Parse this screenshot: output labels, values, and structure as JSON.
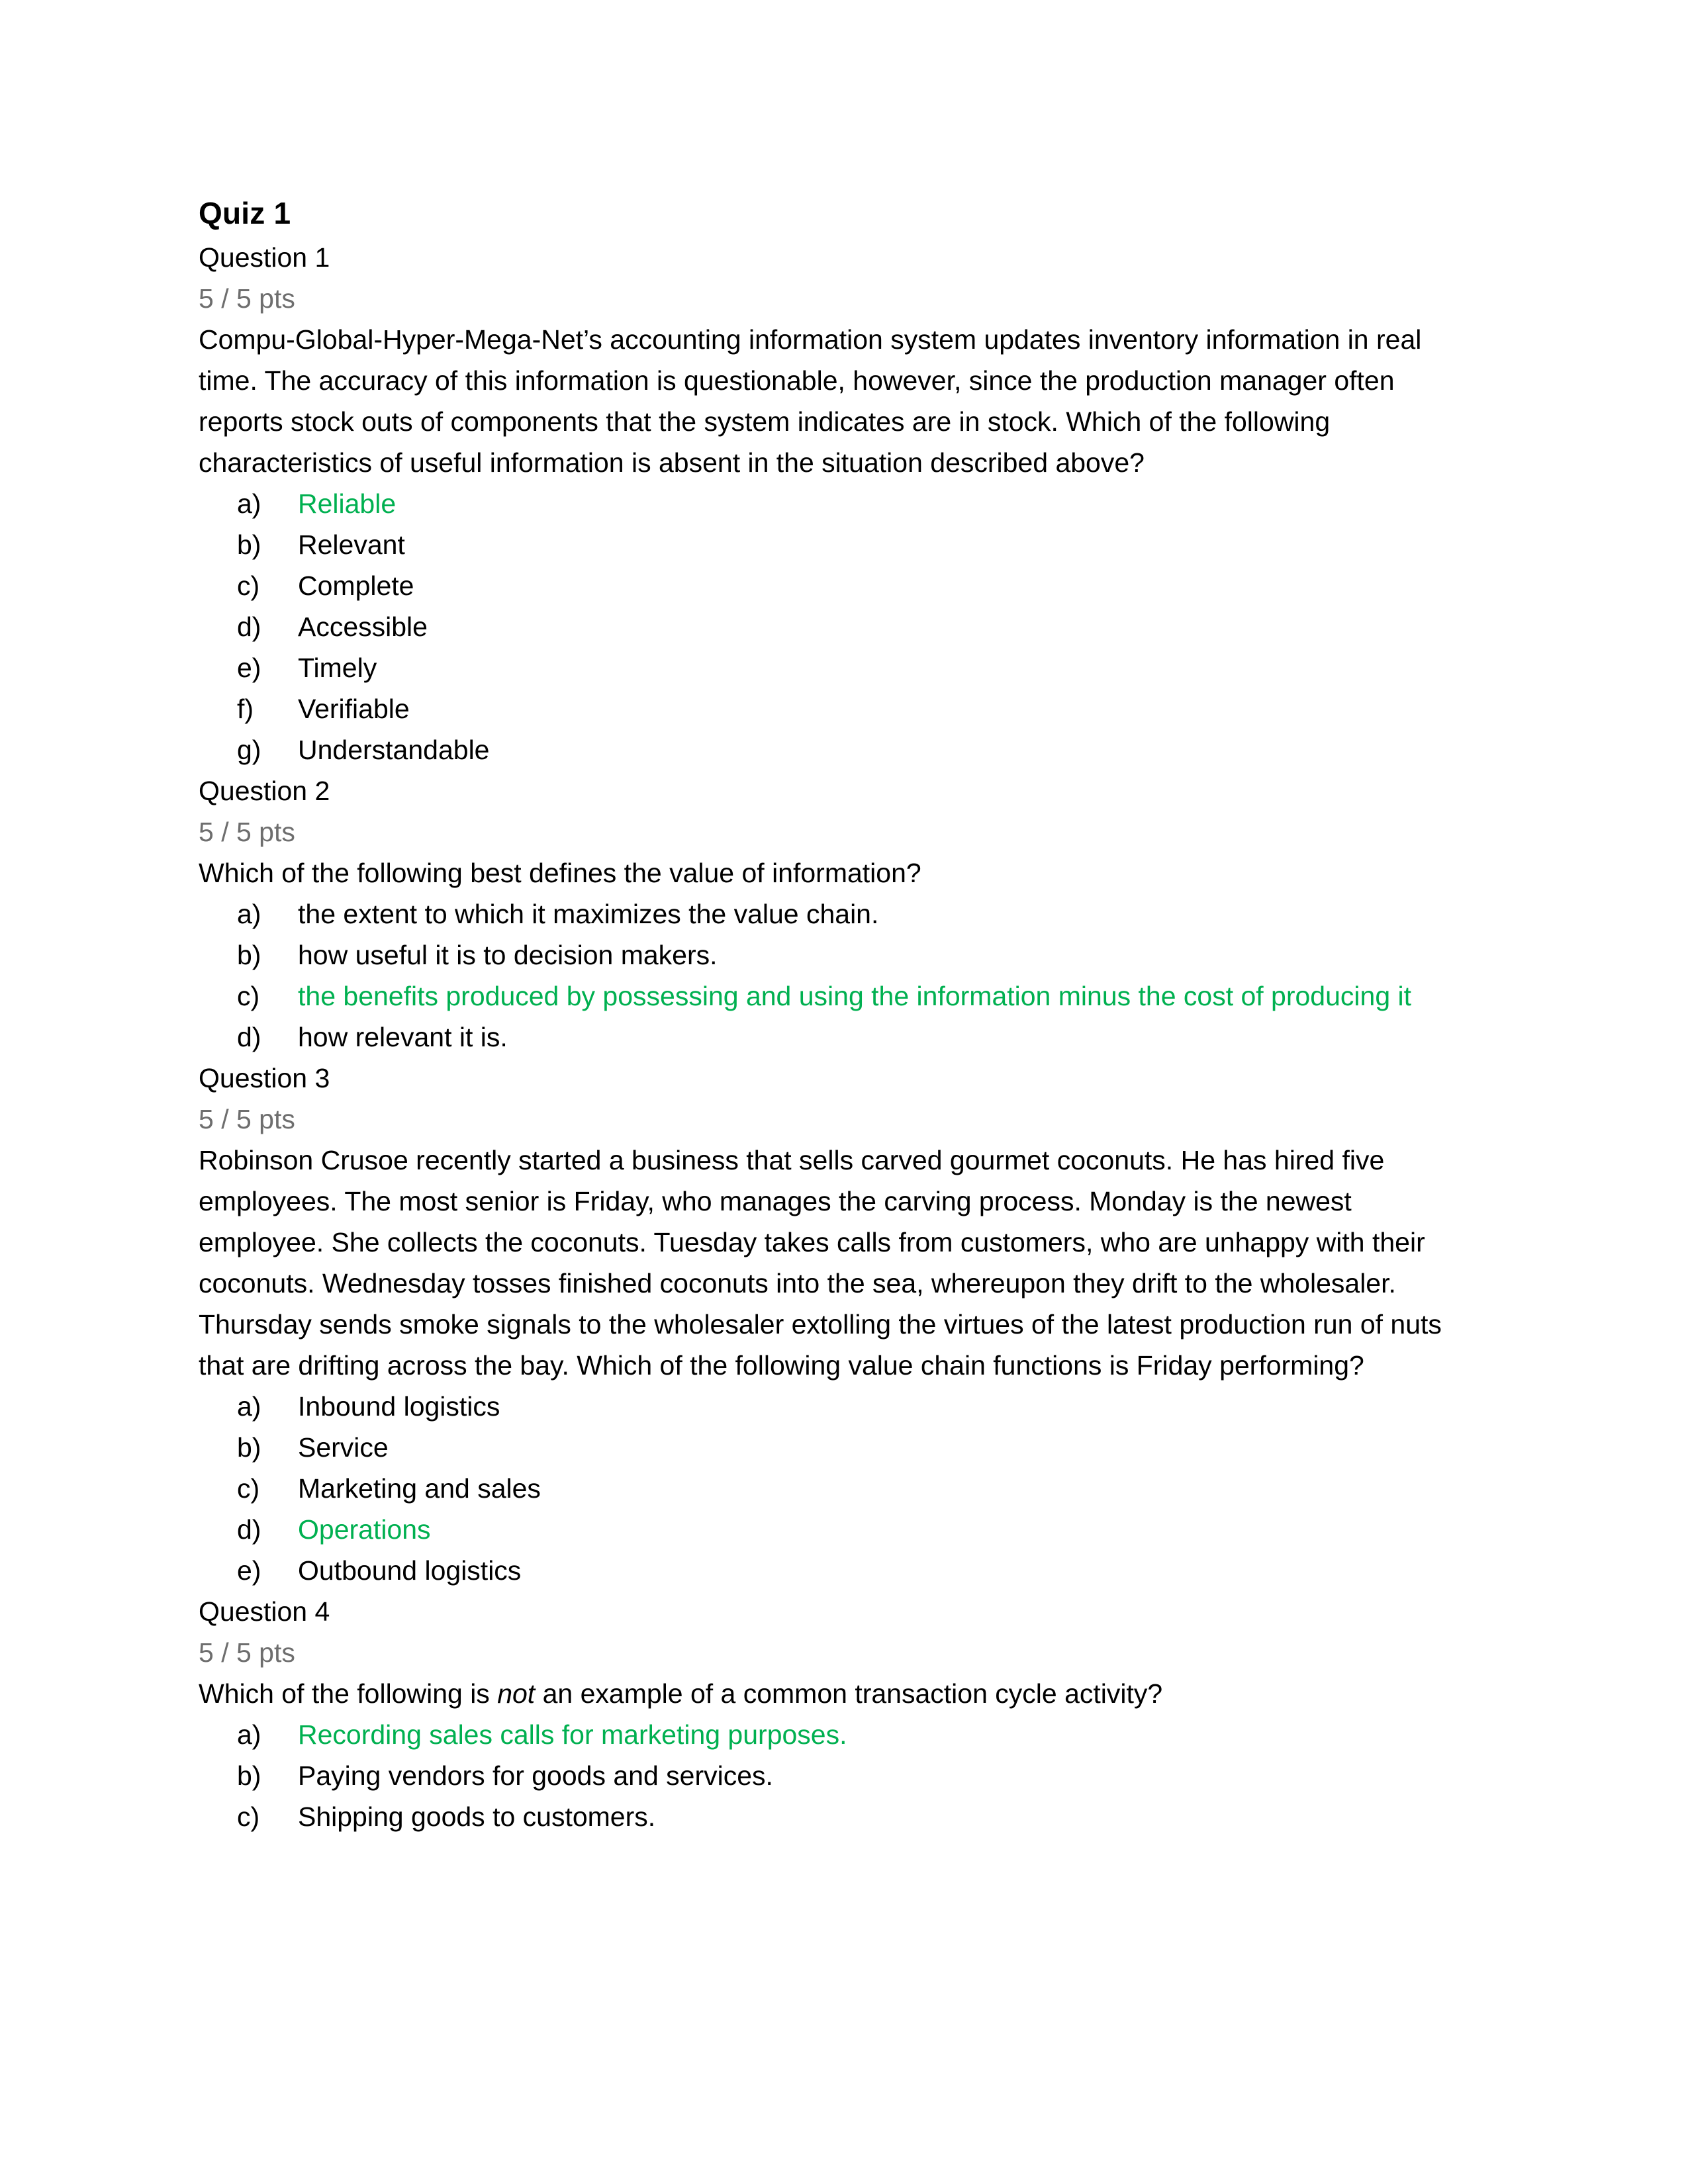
{
  "document": {
    "title": "Quiz 1",
    "correct_answer_color": "#00B050",
    "points_color": "#6E6E6E"
  },
  "questions": [
    {
      "label": "Question 1",
      "points": "5 / 5 pts",
      "body": "Compu-Global-Hyper-Mega-Net’s accounting information system updates inventory information in real time. The accuracy of this information is questionable, however, since the production manager often reports stock outs of components that the system indicates are in stock. Which of the following characteristics of useful information is absent in the situation described above?",
      "options": [
        {
          "marker": "a)",
          "text": "Reliable",
          "correct": true
        },
        {
          "marker": "b)",
          "text": "Relevant",
          "correct": false
        },
        {
          "marker": "c)",
          "text": "Complete",
          "correct": false
        },
        {
          "marker": "d)",
          "text": "Accessible",
          "correct": false
        },
        {
          "marker": "e)",
          "text": "Timely",
          "correct": false
        },
        {
          "marker": "f)",
          "text": "Verifiable",
          "correct": false
        },
        {
          "marker": "g)",
          "text": "Understandable",
          "correct": false
        }
      ]
    },
    {
      "label": "Question 2",
      "points": "5 / 5 pts",
      "body": "Which of the following best defines the value of information?",
      "options": [
        {
          "marker": "a)",
          "text": "the extent to which it maximizes the value chain.",
          "correct": false
        },
        {
          "marker": "b)",
          "text": "how useful it is to decision makers.",
          "correct": false
        },
        {
          "marker": "c)",
          "text": "the benefits produced by possessing and using the information minus the cost of producing it",
          "correct": true
        },
        {
          "marker": "d)",
          "text": "how relevant it is.",
          "correct": false
        }
      ]
    },
    {
      "label": "Question 3",
      "points": "5 / 5 pts",
      "body": "Robinson Crusoe recently started a business that sells carved gourmet coconuts. He has hired five employees. The most senior is Friday, who manages the carving process. Monday is the newest employee. She collects the coconuts. Tuesday takes calls from customers, who are unhappy with their coconuts. Wednesday tosses finished coconuts into the sea, whereupon they drift to the wholesaler. Thursday sends smoke signals to the wholesaler extolling the virtues of the latest production run of nuts that are drifting across the bay. Which of the following value chain functions is Friday performing?",
      "options": [
        {
          "marker": "a)",
          "text": "Inbound logistics",
          "correct": false
        },
        {
          "marker": "b)",
          "text": "Service",
          "correct": false
        },
        {
          "marker": "c)",
          "text": "Marketing and sales",
          "correct": false
        },
        {
          "marker": "d)",
          "text": "Operations",
          "correct": true
        },
        {
          "marker": "e)",
          "text": "Outbound logistics",
          "correct": false
        }
      ]
    },
    {
      "label": "Question 4",
      "points": "5 / 5 pts",
      "body_parts": [
        {
          "text": "Which of the following is ",
          "italic": false
        },
        {
          "text": "not",
          "italic": true
        },
        {
          "text": " an example of a common transaction cycle activity?",
          "italic": false
        }
      ],
      "options": [
        {
          "marker": "a)",
          "text": "Recording sales calls for marketing purposes.",
          "correct": true
        },
        {
          "marker": "b)",
          "text": "Paying vendors for goods and services.",
          "correct": false
        },
        {
          "marker": "c)",
          "text": "Shipping goods to customers.",
          "correct": false
        }
      ]
    }
  ]
}
